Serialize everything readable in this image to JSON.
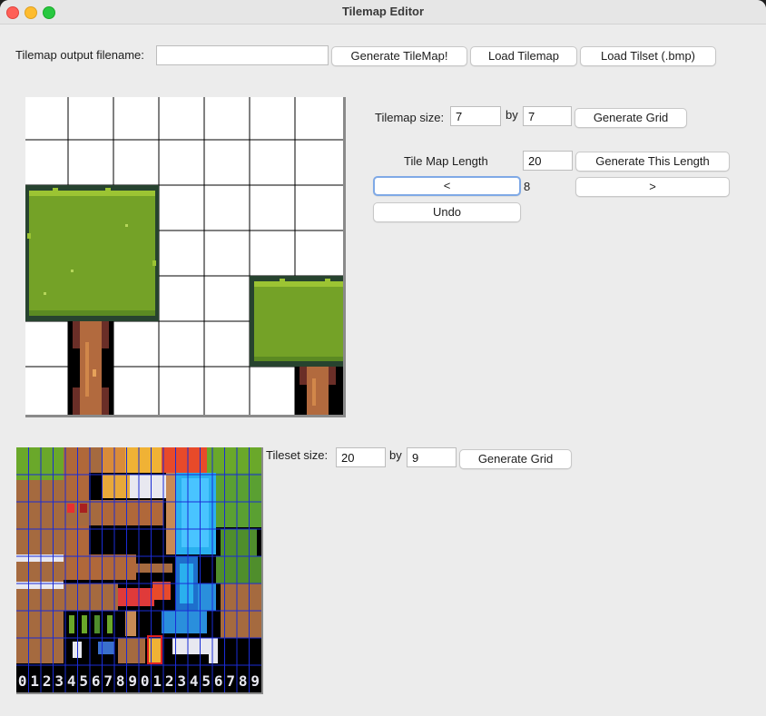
{
  "window": {
    "title": "Tilemap Editor"
  },
  "toolbar": {
    "filename_label": "Tilemap output filename:",
    "filename_value": "",
    "generate_tilemap": "Generate TileMap!",
    "load_tilemap": "Load Tilemap",
    "load_tileset": "Load Tilset (.bmp)"
  },
  "tilemap": {
    "size_label": "Tilemap size:",
    "width": "7",
    "by": "by",
    "height": "7",
    "generate_grid": "Generate Grid",
    "length_label": "Tile Map Length",
    "length_value": "20",
    "generate_length": "Generate This Length",
    "prev": "<",
    "index": "8",
    "next": ">",
    "undo": "Undo"
  },
  "tileset": {
    "size_label": "Tileset size:",
    "width": "20",
    "by": "by",
    "height": "9",
    "generate_grid": "Generate Grid",
    "digits": [
      "0",
      "1",
      "2",
      "3",
      "4",
      "5",
      "6",
      "7",
      "8",
      "9",
      "0",
      "1",
      "2",
      "3",
      "4",
      "5",
      "6",
      "7",
      "8",
      "9"
    ]
  }
}
